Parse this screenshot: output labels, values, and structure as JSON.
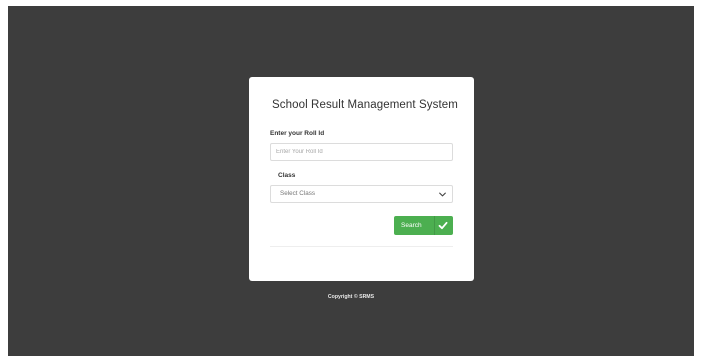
{
  "card": {
    "title": "School Result Management System"
  },
  "roll": {
    "label": "Enter your Roll Id",
    "placeholder": "Enter Your Roll Id",
    "value": ""
  },
  "class_field": {
    "label": "Class",
    "selected": "Select Class"
  },
  "search_button": {
    "label": "Search",
    "icon": "check-icon"
  },
  "footer": {
    "copyright": "Copyright © SRMS"
  },
  "colors": {
    "page_background": "#3d3d3d",
    "card_background": "#ffffff",
    "accent_green": "#4caf50"
  }
}
